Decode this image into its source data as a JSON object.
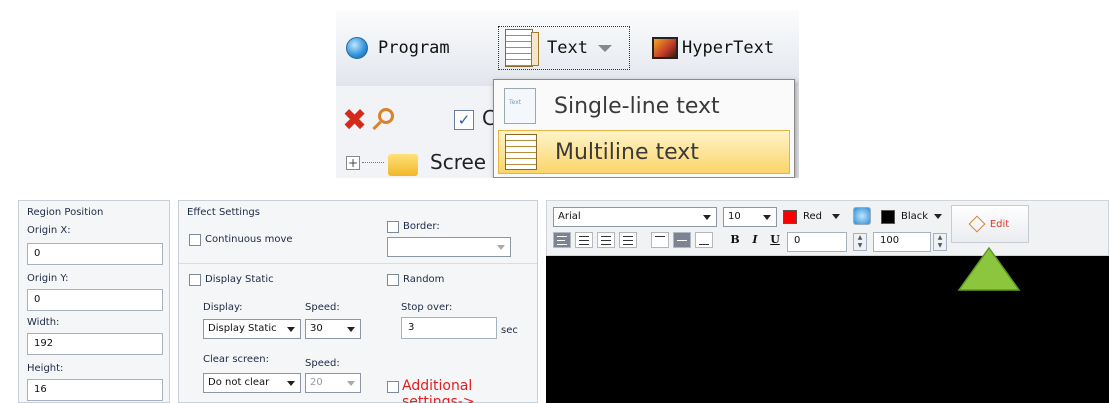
{
  "toolbar": {
    "program_label": "Program",
    "text_label": "Text",
    "hypertext_label": "HyperText"
  },
  "dropdown": {
    "items": [
      {
        "label": "Single-line text",
        "icon": "single-line-text-icon"
      },
      {
        "label": "Multiline text",
        "icon": "multiline-text-icon",
        "highlighted": true
      }
    ]
  },
  "tree": {
    "checkbox_label": "C",
    "screen_label": "Scree"
  },
  "region": {
    "title": "Region Position",
    "origin_x_label": "Origin X:",
    "origin_x": "0",
    "origin_y_label": "Origin Y:",
    "origin_y": "0",
    "width_label": "Width:",
    "width": "192",
    "height_label": "Height:",
    "height": "16"
  },
  "effect": {
    "title": "Effect Settings",
    "continuous_move": "Continuous move",
    "border_label": "Border:",
    "display_static_check": "Display Static",
    "random_label": "Random",
    "display_label": "Display:",
    "display_value": "Display Static",
    "speed_label": "Speed:",
    "speed_value": "30",
    "stop_over_label": "Stop over:",
    "stop_over_value": "3",
    "sec_label": "sec",
    "clear_screen_label": "Clear screen:",
    "clear_value": "Do not clear",
    "speed2_label": "Speed:",
    "speed2_value": "20",
    "additional_settings": "Additional settings->"
  },
  "editor": {
    "font": "Arial",
    "size": "10",
    "color_name": "Red",
    "color_hex": "#ff0000",
    "bg_name": "Black",
    "bg_hex": "#000000",
    "bold": "B",
    "italic": "I",
    "underline": "U",
    "spacing": "0",
    "scale": "100",
    "edit_label": "Edit",
    "canvas_color": "#000000"
  },
  "colors": {
    "accent_green": "#8cc63f",
    "warning_red": "#e02020",
    "highlight": "#fbd56a"
  }
}
